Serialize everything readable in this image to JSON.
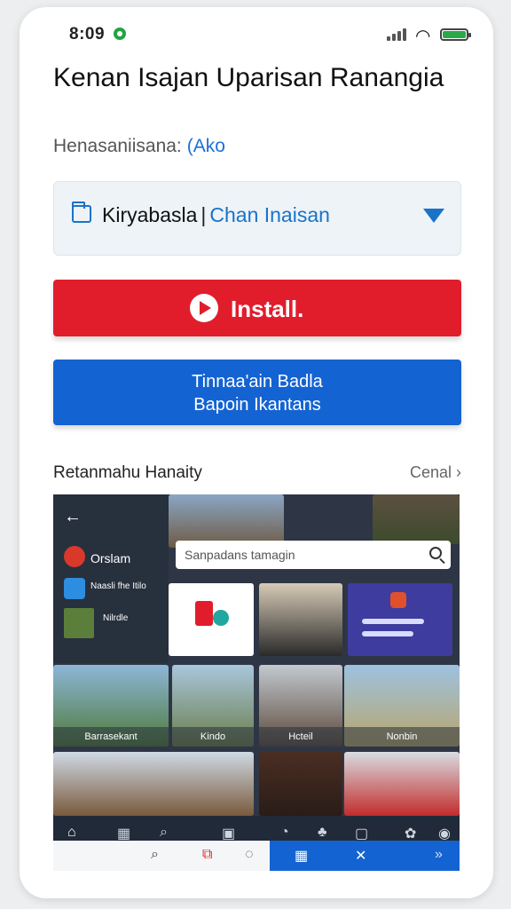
{
  "status_bar": {
    "time": "8:09",
    "wifi_icon": "wifi-icon",
    "battery_icon": "battery-icon"
  },
  "header": {
    "title": "Kenan Isajan Uparisan Ranangia",
    "subtitle": "Henasaniisana:",
    "subtitle_accent": "(Ako"
  },
  "selector": {
    "value": "Kiryabasla",
    "separator": "|",
    "action": "Chan Inaisan",
    "icon": "folder-icon"
  },
  "install_button": {
    "label": "Install.",
    "icon": "play-icon"
  },
  "secondary_button": {
    "line1": "Tinnaa'ain Badla",
    "line2": "Bapoin Ikantans"
  },
  "section": {
    "title": "Retanmahu Hanaity",
    "link": "Cenal ›"
  },
  "gallery": {
    "menu": [
      {
        "label": "Orslam"
      },
      {
        "label": "Naasli fhe Itilo"
      },
      {
        "label": "Nilrdle"
      }
    ],
    "search_placeholder": "Sanpadans tamagin",
    "captions": [
      "Barrasekant",
      "Kindo",
      "Hcteil",
      "Nonbin"
    ]
  },
  "accent_colors": {
    "install": "#e11d2c",
    "primary": "#1463d2",
    "status_green": "#2aa84a"
  }
}
